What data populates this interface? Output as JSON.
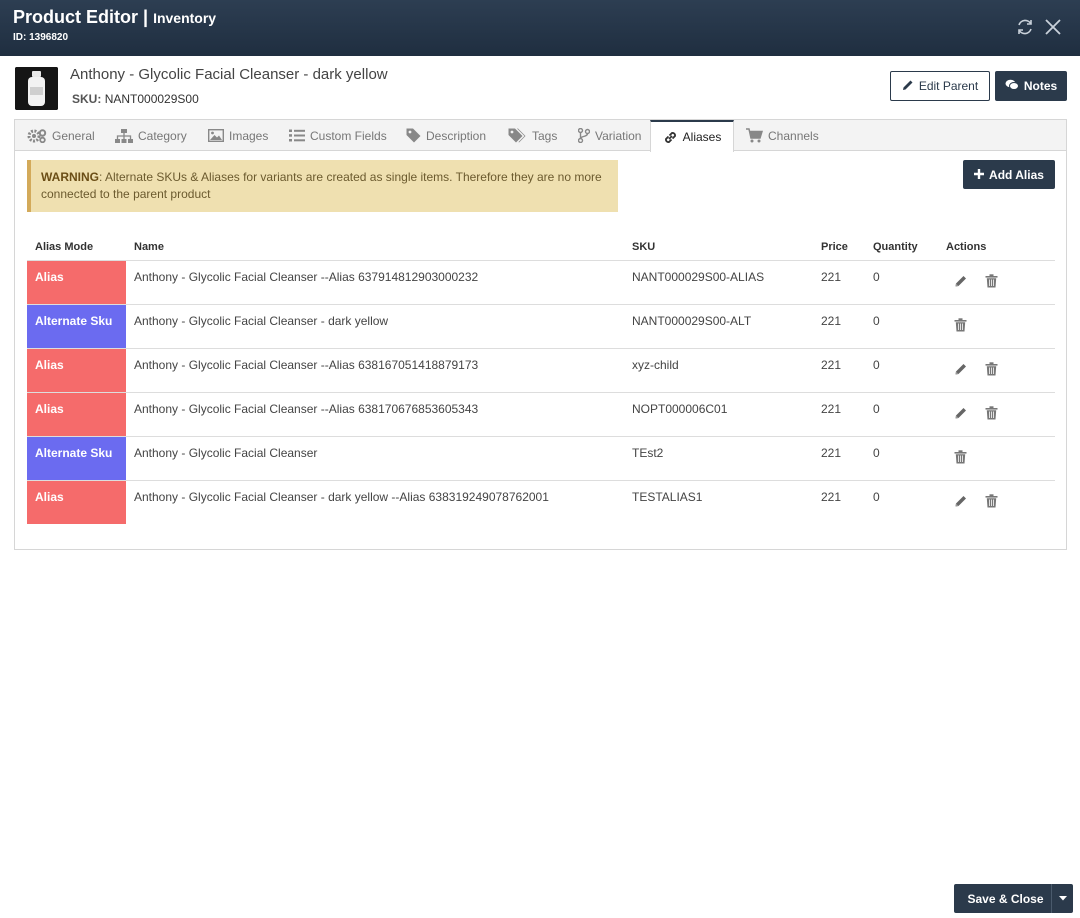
{
  "header": {
    "title": "Product Editor",
    "separator": "|",
    "subtitle": "Inventory",
    "id_label": "ID: 1396820"
  },
  "product": {
    "name": "Anthony - Glycolic Facial Cleanser - dark yellow",
    "sku_label": "SKU:",
    "sku": "NANT000029S00",
    "edit_parent_label": "Edit Parent",
    "notes_label": "Notes"
  },
  "tabs": [
    {
      "label": "General",
      "icon": "gears-icon"
    },
    {
      "label": "Category",
      "icon": "sitemap-icon"
    },
    {
      "label": "Images",
      "icon": "image-icon"
    },
    {
      "label": "Custom Fields",
      "icon": "list-icon"
    },
    {
      "label": "Description",
      "icon": "tag-icon"
    },
    {
      "label": "Tags",
      "icon": "tags-icon"
    },
    {
      "label": "Variation",
      "icon": "branch-icon"
    },
    {
      "label": "Aliases",
      "icon": "link-icon",
      "active": true
    },
    {
      "label": "Channels",
      "icon": "cart-icon"
    }
  ],
  "warning": {
    "strong": "WARNING",
    "text": ": Alternate SKUs & Aliases for variants are created as single items. Therefore they are no more connected to the parent product"
  },
  "add_alias_label": "Add Alias",
  "table": {
    "columns": [
      "Alias Mode",
      "Name",
      "SKU",
      "Price",
      "Quantity",
      "Actions"
    ],
    "rows": [
      {
        "mode": "Alias",
        "name": "Anthony - Glycolic Facial Cleanser --Alias 637914812903000232",
        "sku": "NANT000029S00-ALIAS",
        "price": "221",
        "quantity": "0",
        "editable": true
      },
      {
        "mode": "Alternate Sku",
        "name": "Anthony - Glycolic Facial Cleanser - dark yellow",
        "sku": "NANT000029S00-ALT",
        "price": "221",
        "quantity": "0",
        "editable": false
      },
      {
        "mode": "Alias",
        "name": "Anthony - Glycolic Facial Cleanser --Alias 638167051418879173",
        "sku": "xyz-child",
        "price": "221",
        "quantity": "0",
        "editable": true
      },
      {
        "mode": "Alias",
        "name": "Anthony - Glycolic Facial Cleanser --Alias 638170676853605343",
        "sku": "NOPT000006C01",
        "price": "221",
        "quantity": "0",
        "editable": true
      },
      {
        "mode": "Alternate Sku",
        "name": "Anthony - Glycolic Facial Cleanser",
        "sku": "TEst2",
        "price": "221",
        "quantity": "0",
        "editable": false
      },
      {
        "mode": "Alias",
        "name": "Anthony - Glycolic Facial Cleanser - dark yellow --Alias 638319249078762001",
        "sku": "TESTALIAS1",
        "price": "221",
        "quantity": "0",
        "editable": true
      }
    ]
  },
  "footer": {
    "save_close_label": "Save & Close"
  },
  "colors": {
    "titlebar": "#1f2e40",
    "primary": "#2b3a4b",
    "alias": "#f56b6b",
    "alternate_sku": "#6b6bf0",
    "warning_bg": "#efe0b0"
  }
}
